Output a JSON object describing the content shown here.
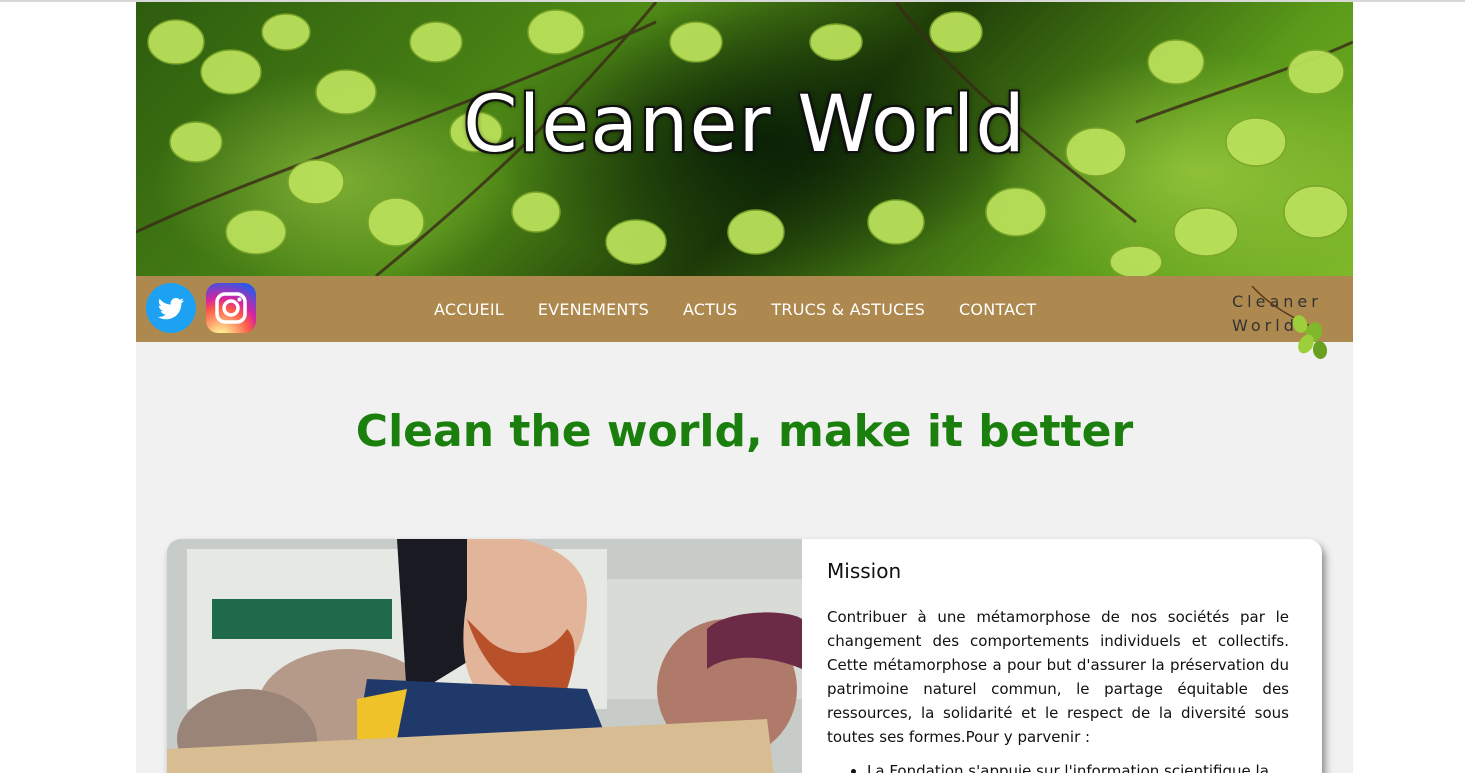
{
  "site": {
    "title": "Cleaner World",
    "logo_line1": "Cleaner",
    "logo_line2": "World"
  },
  "nav": {
    "items": [
      {
        "label": "ACCUEIL"
      },
      {
        "label": "EVENEMENTS"
      },
      {
        "label": "ACTUS"
      },
      {
        "label": "TRUCS & ASTUCES"
      },
      {
        "label": "CONTACT"
      }
    ],
    "social": [
      {
        "icon": "twitter-icon",
        "color": "#1da1f2"
      },
      {
        "icon": "instagram-icon",
        "color": "#d6249f"
      }
    ],
    "background": "#ae894f"
  },
  "headline": "Clean the world, make it better",
  "mission": {
    "title": "Mission",
    "text": "Contribuer à une métamorphose de nos sociétés par le changement des comportements individuels et collectifs. Cette métamorphose a pour but d'assurer la préservation du patrimoine naturel commun, le partage équitable des ressources, la solidarité et le respect de la diversité sous toutes ses formes.Pour y parvenir :",
    "list": [
      "La Fondation s'appuie sur l'information scientifique la"
    ]
  },
  "colors": {
    "headline": "#1a7f0c",
    "page_background": "#f1f1f1"
  }
}
